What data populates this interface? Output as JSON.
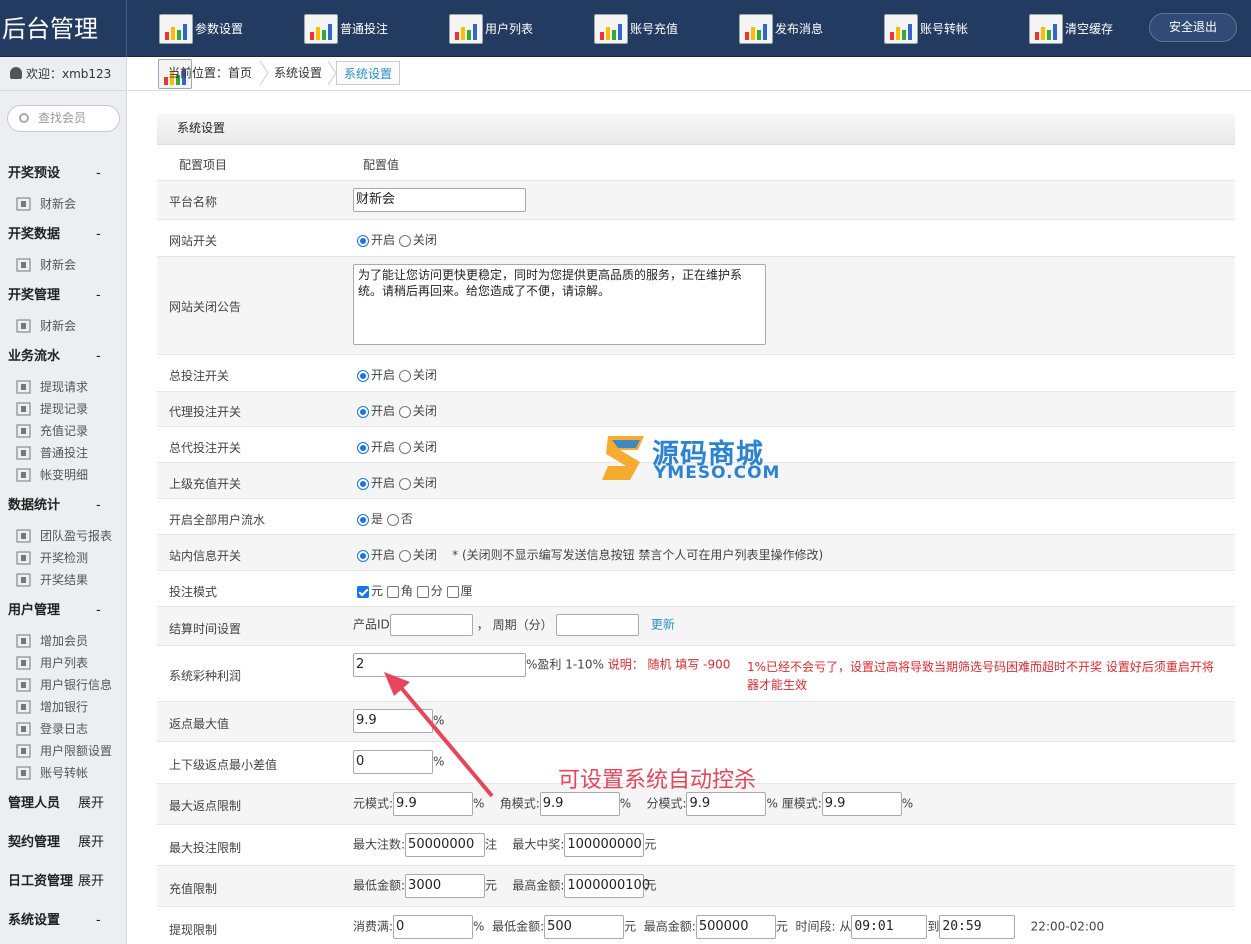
{
  "brand": "后台管理",
  "topnav": [
    "参数设置",
    "普通投注",
    "用户列表",
    "账号充值",
    "发布消息",
    "账号转帐",
    "清空缓存"
  ],
  "logout": "安全退出",
  "welcome": "欢迎：xmb123",
  "search_placeholder": "查找会员",
  "breadcrumb": {
    "prefix": "当前位置：",
    "home": "首页",
    "items": [
      "系统设置",
      "系统设置"
    ]
  },
  "sidebar": {
    "groups": [
      {
        "title": "开奖预设",
        "toggle": "-",
        "items": [
          "财新会"
        ]
      },
      {
        "title": "开奖数据",
        "toggle": "-",
        "items": [
          "财新会"
        ]
      },
      {
        "title": "开奖管理",
        "toggle": "-",
        "items": [
          "财新会"
        ]
      },
      {
        "title": "业务流水",
        "toggle": "-",
        "items": [
          "提现请求",
          "提现记录",
          "充值记录",
          "普通投注",
          "帐变明细"
        ]
      },
      {
        "title": "数据统计",
        "toggle": "-",
        "items": [
          "团队盈亏报表",
          "开奖检测",
          "开奖结果"
        ]
      },
      {
        "title": "用户管理",
        "toggle": "-",
        "items": [
          "增加会员",
          "用户列表",
          "用户银行信息",
          "增加银行",
          "登录日志",
          "用户限额设置",
          "账号转帐"
        ]
      },
      {
        "title": "管理人员",
        "toggle": "展开",
        "items": []
      },
      {
        "title": "契约管理",
        "toggle": "展开",
        "items": []
      },
      {
        "title": "日工资管理",
        "toggle": "展开",
        "items": []
      },
      {
        "title": "系统设置",
        "toggle": "-",
        "items": []
      }
    ]
  },
  "section_title": "系统设置",
  "col_headers": [
    "配置项目",
    "配置值"
  ],
  "rows": {
    "platform_name": {
      "label": "平台名称",
      "value": "财新会"
    },
    "site_switch": {
      "label": "网站开关",
      "on": "开启",
      "off": "关闭"
    },
    "close_notice": {
      "label": "网站关闭公告",
      "value": "为了能让您访问更快更稳定，同时为您提供更高品质的服务，正在维护系统。请稍后再回来。给您造成了不便，请谅解。"
    },
    "total_bet": {
      "label": "总投注开关",
      "on": "开启",
      "off": "关闭"
    },
    "agent_bet": {
      "label": "代理投注开关",
      "on": "开启",
      "off": "关闭"
    },
    "general_agent_bet": {
      "label": "总代投注开关",
      "on": "开启",
      "off": "关闭"
    },
    "upper_recharge": {
      "label": "上级充值开关",
      "on": "开启",
      "off": "关闭"
    },
    "user_flow": {
      "label": "开启全部用户流水",
      "on": "是",
      "off": "否"
    },
    "msg_switch": {
      "label": "站内信息开关",
      "on": "开启",
      "off": "关闭",
      "note": "* (关闭则不显示编写发送信息按钮 禁言个人可在用户列表里操作修改)"
    },
    "bet_mode": {
      "label": "投注模式",
      "opts": [
        "元",
        "角",
        "分",
        "厘"
      ]
    },
    "settle_time": {
      "label": "结算时间设置",
      "pid": "产品ID",
      "period": "，  周期（分）",
      "update": "更新"
    },
    "profit": {
      "label": "系统彩种利润",
      "value": "2",
      "suffix": "%盈利 1-10%",
      "note1": "说明： 随机 填写 -900",
      "note2": "1%已经不会亏了，设置过高将导致当期筛选号码困难而超时不开奖 设置好后须重启开将器才能生效"
    },
    "rebate_max": {
      "label": "返点最大值",
      "value": "9.9",
      "unit": "%"
    },
    "rebate_diff": {
      "label": "上下级返点最小差值",
      "value": "0",
      "unit": "%"
    },
    "rebate_limit": {
      "label": "最大返点限制",
      "yuan": "元模式:",
      "yuan_v": "9.9",
      "jiao": "角模式:",
      "jiao_v": "9.9",
      "fen": "分模式:",
      "fen_v": "9.9",
      "li": "厘模式:",
      "li_v": "9.9",
      "unit": "%"
    },
    "bet_limit": {
      "label": "最大投注限制",
      "max_bets": "最大注数:",
      "max_bets_v": "50000000",
      "bets_unit": "注",
      "max_win": "最大中奖:",
      "max_win_v": "100000000",
      "win_unit": "元"
    },
    "recharge_limit": {
      "label": "充值限制",
      "min": "最低金额:",
      "min_v": "3000",
      "max": "最高金额:",
      "max_v": "1000000100",
      "unit": "元"
    },
    "withdraw_limit": {
      "label": "提现限制",
      "consume": "消费满:",
      "consume_v": "0",
      "pct": "%",
      "min": "最低金额:",
      "min_v": "500",
      "max": "最高金额:",
      "max_v": "500000",
      "unit": "元",
      "time": "时间段:",
      "from": "从",
      "from_v": "09:01",
      "to": "到",
      "to_v": "20:59",
      "range": "22:00-02:00"
    }
  },
  "watermark": {
    "cn": "源码商城",
    "en": "YMESO.COM"
  },
  "annotation": "可设置系统自动控杀",
  "colors": {
    "topbar": "#233b61",
    "accent": "#1a73e8",
    "red": "#e0282e",
    "annotation": "#e8455a"
  }
}
